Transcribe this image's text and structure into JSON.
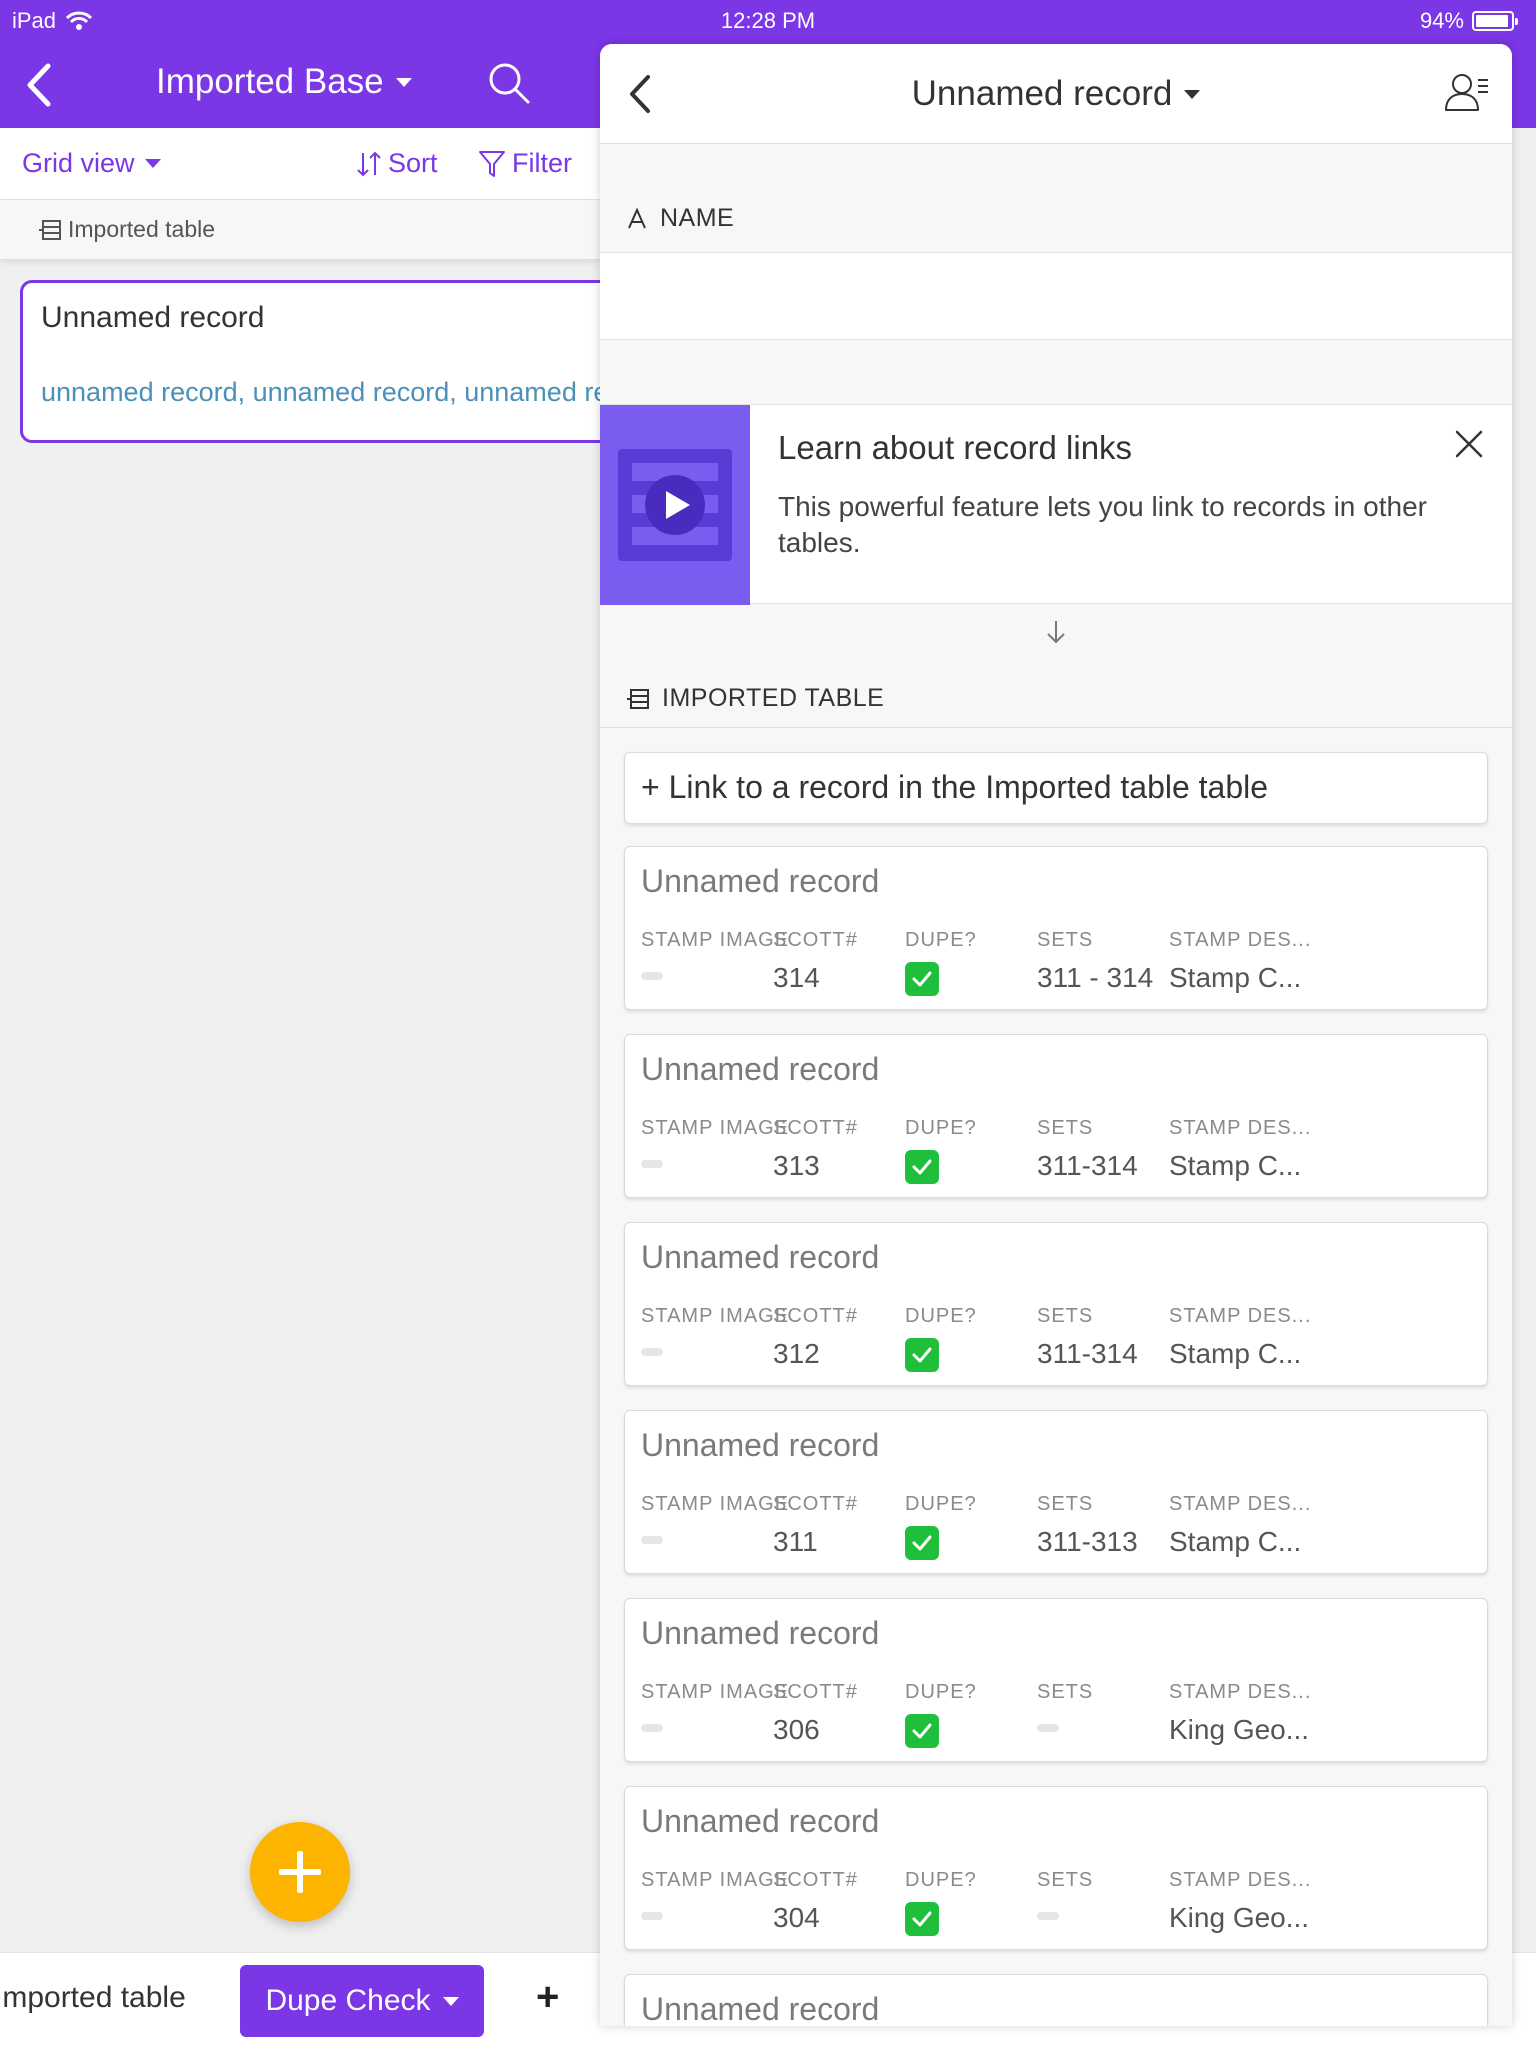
{
  "status_bar": {
    "device": "iPad",
    "time": "12:28 PM",
    "battery": "94%"
  },
  "header": {
    "base_title": "Imported Base"
  },
  "toolbar": {
    "view": "Grid view",
    "sort": "Sort",
    "filter": "Filter"
  },
  "table_bar": {
    "label": "Imported table"
  },
  "record": {
    "title": "Unnamed record",
    "links": "unnamed record, unnamed record, unnamed record"
  },
  "panel": {
    "title": "Unnamed record",
    "name_label": "NAME",
    "name_value": "",
    "promo": {
      "title": "Learn about record links",
      "text": "This powerful feature lets you link to records in other tables."
    },
    "table_label": "IMPORTED TABLE",
    "link_button": "+ Link to a record in the Imported table table",
    "field_labels": {
      "stamp_image": "STAMP IMAGE",
      "scott": "SCOTT#",
      "dupe": "DUPE?",
      "sets": "SETS",
      "stamp_des": "STAMP DES..."
    },
    "linked_records": [
      {
        "title": "Unnamed record",
        "scott": "314",
        "sets": "311 - 314",
        "desc": "Stamp C..."
      },
      {
        "title": "Unnamed record",
        "scott": "313",
        "sets": "311-314",
        "desc": "Stamp C..."
      },
      {
        "title": "Unnamed record",
        "scott": "312",
        "sets": "311-314",
        "desc": "Stamp C..."
      },
      {
        "title": "Unnamed record",
        "scott": "311",
        "sets": "311-313",
        "desc": "Stamp C..."
      },
      {
        "title": "Unnamed record",
        "scott": "306",
        "sets": "",
        "desc": "King Geo..."
      },
      {
        "title": "Unnamed record",
        "scott": "304",
        "sets": "",
        "desc": "King Geo..."
      },
      {
        "title": "Unnamed record",
        "scott": "",
        "sets": "",
        "desc": ""
      }
    ]
  },
  "bottom_tabs": {
    "imported": "Imported table",
    "dupe_check": "Dupe Check",
    "add": "+"
  },
  "colors": {
    "brand": "#7b36e6",
    "fab": "#fcb400",
    "link": "#4a90b8",
    "check": "#1fbf3c"
  },
  "icons": [
    "wifi-icon",
    "battery-icon",
    "back-icon",
    "caret-down-icon",
    "search-icon",
    "sort-icon",
    "filter-icon",
    "table-icon",
    "collaborator-icon",
    "text-field-icon",
    "play-icon",
    "close-icon",
    "arrow-down-icon",
    "checkbox-checked-icon",
    "plus-icon"
  ]
}
